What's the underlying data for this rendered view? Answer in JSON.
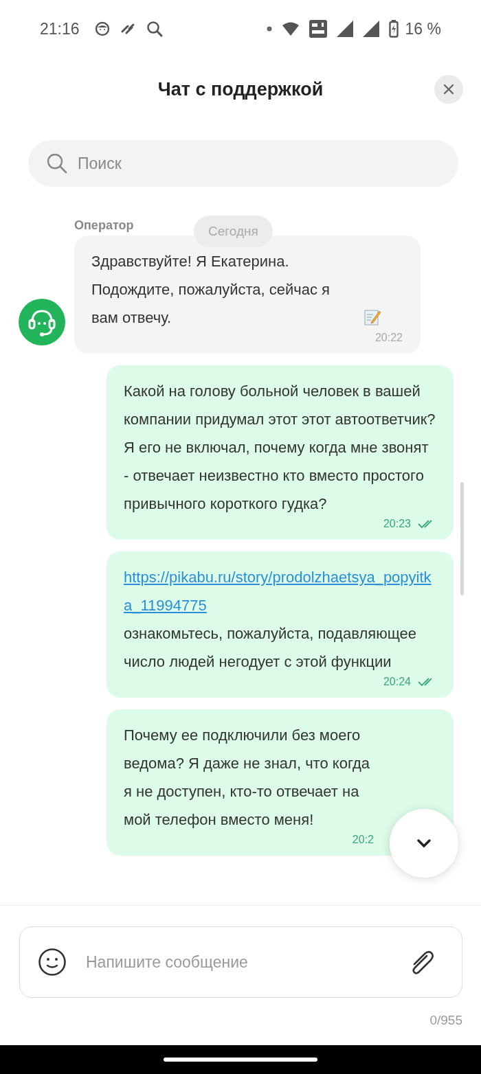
{
  "status_bar": {
    "time": "21:16",
    "battery": "16 %"
  },
  "header": {
    "title": "Чат с поддержкой"
  },
  "search": {
    "placeholder": "Поиск"
  },
  "date_chip": "Сегодня",
  "messages": [
    {
      "kind": "incoming",
      "sender": "Оператор",
      "text": "Здравствуйте! Я Екатерина. Подождите, пожалуйста, сейчас я вам отвечу.",
      "memo_icon": true,
      "time": "20:22"
    },
    {
      "kind": "outgoing",
      "text": "Какой на голову больной человек в вашей компании придумал этот этот автоответчик? Я его не включал, почему когда мне звонят - отвечает неизвестно кто вместо простого привычного короткого гудка?",
      "time": "20:23",
      "read": true
    },
    {
      "kind": "outgoing",
      "link": "https://pikabu.ru/story/prodolzhaetsya_popyitka_11994775",
      "text": "ознакомьтесь, пожалуйста, подавляющее число людей негодует с этой функции",
      "time": "20:24",
      "read": true
    },
    {
      "kind": "outgoing",
      "text": "Почему ее подключили без моего ведома? Я даже не знал, что когда я не доступен, кто-то отвечает на мой телефон вместо меня!",
      "time": "20:2"
    }
  ],
  "composer": {
    "placeholder": "Напишите сообщение",
    "counter": "0/955"
  }
}
